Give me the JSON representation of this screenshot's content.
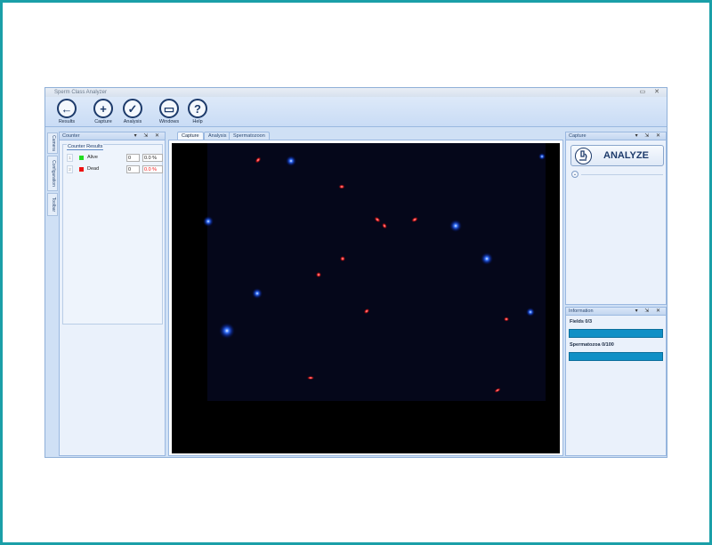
{
  "window": {
    "title": "Sperm Class Analyzer",
    "controls": "▭ ✕"
  },
  "ribbon": {
    "buttons": [
      {
        "label": "Results",
        "glyph": "←",
        "icon": "back-arrow-icon"
      },
      {
        "label": "Capture",
        "glyph": "+",
        "icon": "capture-icon"
      },
      {
        "label": "Analysis",
        "glyph": "✓",
        "icon": "analysis-icon"
      },
      {
        "label": "Windows",
        "glyph": "▭",
        "icon": "windows-icon"
      },
      {
        "label": "Help",
        "glyph": "?",
        "icon": "help-icon"
      }
    ]
  },
  "left_tabs": [
    "Camera",
    "Configuration",
    "Toolbar"
  ],
  "counter_panel": {
    "title": "Counter",
    "controls": "▾ ⇲ ✕",
    "group_label": "Counter Results",
    "rows": [
      {
        "index": "1",
        "name": "Alive",
        "count": "0",
        "percent": "0.0 %",
        "swatch": "#22dd22",
        "percent_color": "#222222"
      },
      {
        "index": "2",
        "name": "Dead",
        "count": "0",
        "percent": "0.0 %",
        "swatch": "#ee1111",
        "percent_color": "#ee1111"
      }
    ]
  },
  "doc_tabs": [
    "Capture",
    "Analysis",
    "Spermatozoon"
  ],
  "capture_panel": {
    "title": "Capture",
    "controls": "▾ ⇲ ✕",
    "analyze_label": "ANALYZE",
    "expand_glyph": "⌄"
  },
  "info_panel": {
    "title": "Information",
    "controls": "▾ ⇲ ✕",
    "fields_label": "Fields 0/3",
    "sperm_label": "Spermatozoa 0/100"
  },
  "colors": {
    "accent": "#1090c6",
    "frame": "#1a9fa8",
    "blue_cell": "#1a5cff",
    "red_cell": "#ff2a2a"
  }
}
